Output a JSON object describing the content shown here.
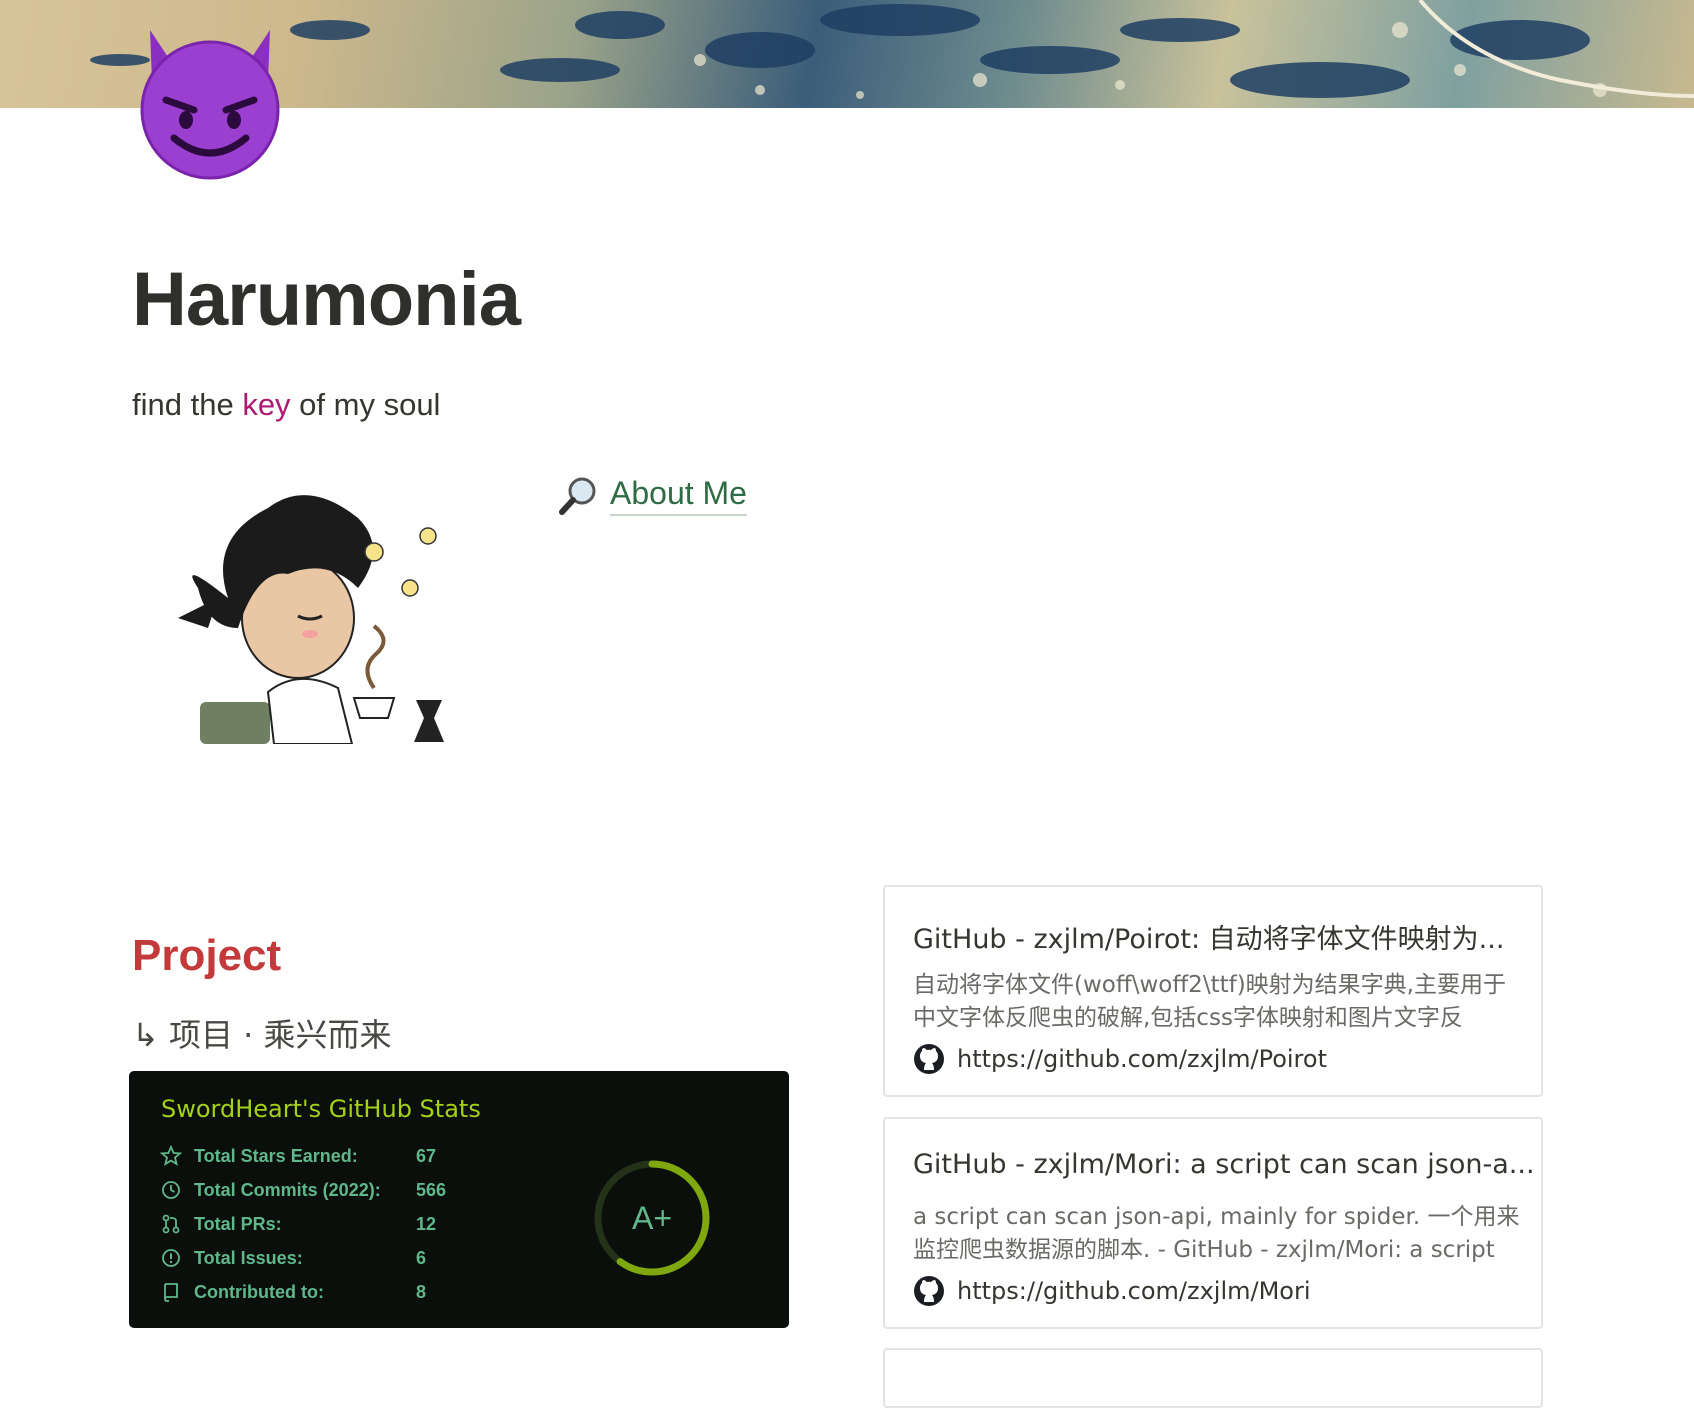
{
  "page": {
    "title": "Harumonia",
    "subtitle_before": "find the ",
    "subtitle_key": "key",
    "subtitle_after": " of my soul",
    "icon": "smiling-devil-icon"
  },
  "about": {
    "label": "About Me",
    "icon": "magnifier-icon"
  },
  "project": {
    "heading": "Project",
    "subheading": "↳ 项目 · 乘兴而来"
  },
  "stats": {
    "title": "SwordHeart's GitHub Stats",
    "rows": [
      {
        "icon": "star-icon",
        "label": "Total Stars Earned:",
        "value": "67"
      },
      {
        "icon": "history-icon",
        "label": "Total Commits (2022):",
        "value": "566"
      },
      {
        "icon": "pull-request-icon",
        "label": "Total PRs:",
        "value": "12"
      },
      {
        "icon": "issue-icon",
        "label": "Total Issues:",
        "value": "6"
      },
      {
        "icon": "repo-icon",
        "label": "Contributed to:",
        "value": "8"
      }
    ],
    "grade": "A+",
    "grade_progress": 0.6,
    "colors": {
      "title": "#a3d118",
      "text": "#5fb78a",
      "ring": "#7ea80e",
      "bg": "#0b0f0c"
    }
  },
  "cards": [
    {
      "title": "GitHub - zxjlm/Poirot: 自动将字体文件映射为...",
      "desc": "自动将字体文件(woff\\woff2\\ttf)映射为结果字典,主要用于中文字体反爬虫的破解,包括css字体映射和图片文字反",
      "url": "https://github.com/zxjlm/Poirot"
    },
    {
      "title": "GitHub - zxjlm/Mori: a script can scan json-a...",
      "desc": "a script can scan json-api, mainly for spider. 一个用来监控爬虫数据源的脚本. - GitHub - zxjlm/Mori: a script",
      "url": "https://github.com/zxjlm/Mori"
    }
  ]
}
